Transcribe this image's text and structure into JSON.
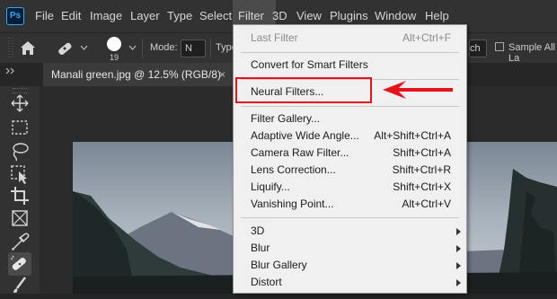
{
  "app": {
    "logo_text": "Ps"
  },
  "menubar": {
    "items": [
      "File",
      "Edit",
      "Image",
      "Layer",
      "Type",
      "Select",
      "Filter",
      "3D",
      "View",
      "Plugins",
      "Window",
      "Help"
    ],
    "active": "Filter"
  },
  "options": {
    "brush_size": "19",
    "mode_label": "Mode:",
    "mode_value": "N",
    "type_label": "Type",
    "cut_text": "ch",
    "sample_all_label": "Sample All La"
  },
  "document": {
    "tab_title": "Manali green.jpg @ 12.5% (RGB/8)",
    "close_symbol": "×"
  },
  "filter_menu": {
    "items": [
      {
        "label": "Last Filter",
        "shortcut": "Alt+Ctrl+F",
        "disabled": true
      },
      {
        "label": "Convert for Smart Filters",
        "shortcut": ""
      },
      {
        "label": "Neural Filters...",
        "shortcut": ""
      },
      {
        "label": "Filter Gallery...",
        "shortcut": ""
      },
      {
        "label": "Adaptive Wide Angle...",
        "shortcut": "Alt+Shift+Ctrl+A"
      },
      {
        "label": "Camera Raw Filter...",
        "shortcut": "Shift+Ctrl+A"
      },
      {
        "label": "Lens Correction...",
        "shortcut": "Shift+Ctrl+R"
      },
      {
        "label": "Liquify...",
        "shortcut": "Shift+Ctrl+X"
      },
      {
        "label": "Vanishing Point...",
        "shortcut": "Alt+Ctrl+V"
      },
      {
        "label": "3D",
        "shortcut": "",
        "submenu": true
      },
      {
        "label": "Blur",
        "shortcut": "",
        "submenu": true
      },
      {
        "label": "Blur Gallery",
        "shortcut": "",
        "submenu": true
      },
      {
        "label": "Distort",
        "shortcut": "",
        "submenu": true
      }
    ]
  },
  "colors": {
    "highlight_box": "#e8121b",
    "accent": "#31a8ff"
  },
  "icons": [
    "home-icon",
    "healing-brush-icon",
    "move-tool-icon",
    "marquee-tool-icon",
    "lasso-tool-icon",
    "object-select-icon",
    "crop-tool-icon",
    "frame-tool-icon",
    "eyedropper-icon",
    "spot-healing-icon",
    "brush-tool-icon"
  ]
}
